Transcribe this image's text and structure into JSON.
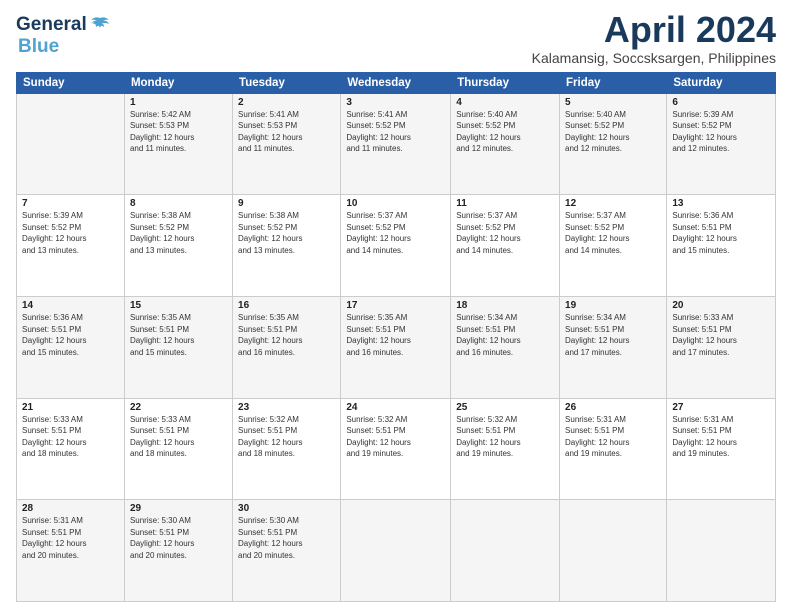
{
  "header": {
    "logo_line1": "General",
    "logo_line2": "Blue",
    "title": "April 2024",
    "subtitle": "Kalamansig, Soccsksargen, Philippines"
  },
  "weekdays": [
    "Sunday",
    "Monday",
    "Tuesday",
    "Wednesday",
    "Thursday",
    "Friday",
    "Saturday"
  ],
  "weeks": [
    [
      {
        "day": "",
        "info": ""
      },
      {
        "day": "1",
        "info": "Sunrise: 5:42 AM\nSunset: 5:53 PM\nDaylight: 12 hours\nand 11 minutes."
      },
      {
        "day": "2",
        "info": "Sunrise: 5:41 AM\nSunset: 5:53 PM\nDaylight: 12 hours\nand 11 minutes."
      },
      {
        "day": "3",
        "info": "Sunrise: 5:41 AM\nSunset: 5:52 PM\nDaylight: 12 hours\nand 11 minutes."
      },
      {
        "day": "4",
        "info": "Sunrise: 5:40 AM\nSunset: 5:52 PM\nDaylight: 12 hours\nand 12 minutes."
      },
      {
        "day": "5",
        "info": "Sunrise: 5:40 AM\nSunset: 5:52 PM\nDaylight: 12 hours\nand 12 minutes."
      },
      {
        "day": "6",
        "info": "Sunrise: 5:39 AM\nSunset: 5:52 PM\nDaylight: 12 hours\nand 12 minutes."
      }
    ],
    [
      {
        "day": "7",
        "info": "Sunrise: 5:39 AM\nSunset: 5:52 PM\nDaylight: 12 hours\nand 13 minutes."
      },
      {
        "day": "8",
        "info": "Sunrise: 5:38 AM\nSunset: 5:52 PM\nDaylight: 12 hours\nand 13 minutes."
      },
      {
        "day": "9",
        "info": "Sunrise: 5:38 AM\nSunset: 5:52 PM\nDaylight: 12 hours\nand 13 minutes."
      },
      {
        "day": "10",
        "info": "Sunrise: 5:37 AM\nSunset: 5:52 PM\nDaylight: 12 hours\nand 14 minutes."
      },
      {
        "day": "11",
        "info": "Sunrise: 5:37 AM\nSunset: 5:52 PM\nDaylight: 12 hours\nand 14 minutes."
      },
      {
        "day": "12",
        "info": "Sunrise: 5:37 AM\nSunset: 5:52 PM\nDaylight: 12 hours\nand 14 minutes."
      },
      {
        "day": "13",
        "info": "Sunrise: 5:36 AM\nSunset: 5:51 PM\nDaylight: 12 hours\nand 15 minutes."
      }
    ],
    [
      {
        "day": "14",
        "info": "Sunrise: 5:36 AM\nSunset: 5:51 PM\nDaylight: 12 hours\nand 15 minutes."
      },
      {
        "day": "15",
        "info": "Sunrise: 5:35 AM\nSunset: 5:51 PM\nDaylight: 12 hours\nand 15 minutes."
      },
      {
        "day": "16",
        "info": "Sunrise: 5:35 AM\nSunset: 5:51 PM\nDaylight: 12 hours\nand 16 minutes."
      },
      {
        "day": "17",
        "info": "Sunrise: 5:35 AM\nSunset: 5:51 PM\nDaylight: 12 hours\nand 16 minutes."
      },
      {
        "day": "18",
        "info": "Sunrise: 5:34 AM\nSunset: 5:51 PM\nDaylight: 12 hours\nand 16 minutes."
      },
      {
        "day": "19",
        "info": "Sunrise: 5:34 AM\nSunset: 5:51 PM\nDaylight: 12 hours\nand 17 minutes."
      },
      {
        "day": "20",
        "info": "Sunrise: 5:33 AM\nSunset: 5:51 PM\nDaylight: 12 hours\nand 17 minutes."
      }
    ],
    [
      {
        "day": "21",
        "info": "Sunrise: 5:33 AM\nSunset: 5:51 PM\nDaylight: 12 hours\nand 18 minutes."
      },
      {
        "day": "22",
        "info": "Sunrise: 5:33 AM\nSunset: 5:51 PM\nDaylight: 12 hours\nand 18 minutes."
      },
      {
        "day": "23",
        "info": "Sunrise: 5:32 AM\nSunset: 5:51 PM\nDaylight: 12 hours\nand 18 minutes."
      },
      {
        "day": "24",
        "info": "Sunrise: 5:32 AM\nSunset: 5:51 PM\nDaylight: 12 hours\nand 19 minutes."
      },
      {
        "day": "25",
        "info": "Sunrise: 5:32 AM\nSunset: 5:51 PM\nDaylight: 12 hours\nand 19 minutes."
      },
      {
        "day": "26",
        "info": "Sunrise: 5:31 AM\nSunset: 5:51 PM\nDaylight: 12 hours\nand 19 minutes."
      },
      {
        "day": "27",
        "info": "Sunrise: 5:31 AM\nSunset: 5:51 PM\nDaylight: 12 hours\nand 19 minutes."
      }
    ],
    [
      {
        "day": "28",
        "info": "Sunrise: 5:31 AM\nSunset: 5:51 PM\nDaylight: 12 hours\nand 20 minutes."
      },
      {
        "day": "29",
        "info": "Sunrise: 5:30 AM\nSunset: 5:51 PM\nDaylight: 12 hours\nand 20 minutes."
      },
      {
        "day": "30",
        "info": "Sunrise: 5:30 AM\nSunset: 5:51 PM\nDaylight: 12 hours\nand 20 minutes."
      },
      {
        "day": "",
        "info": ""
      },
      {
        "day": "",
        "info": ""
      },
      {
        "day": "",
        "info": ""
      },
      {
        "day": "",
        "info": ""
      }
    ]
  ]
}
